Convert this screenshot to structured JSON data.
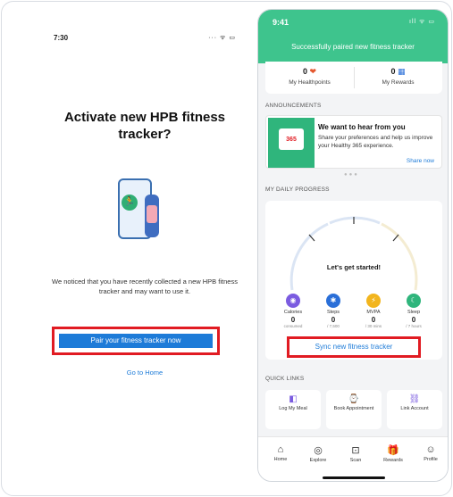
{
  "left": {
    "status_time": "7:30",
    "status_icons": "··· ᯤ ▭",
    "title": "Activate new HPB fitness tracker?",
    "description": "We noticed that you have recently collected a new HPB fitness tracker and may want to use it.",
    "pair_button": "Pair your fitness tracker now",
    "home_link": "Go to Home"
  },
  "right": {
    "status_time": "9:41",
    "status_icons": "ıll ᯤ ▭",
    "banner": "Successfully paired new fitness tracker",
    "healthpoints": {
      "value": "0",
      "label": "My Healthpoints"
    },
    "rewards": {
      "value": "0",
      "label": "My Rewards"
    },
    "announcements_header": "ANNOUNCEMENTS",
    "announcement": {
      "badge": "365",
      "title": "We want to hear from you",
      "body": "Share your preferences and help us improve your Healthy 365 experience.",
      "more": "Share now"
    },
    "progress_header": "MY DAILY PROGRESS",
    "progress_start": "Let's get started!",
    "metrics": [
      {
        "name": "Calories",
        "value": "0",
        "unit": "consumed",
        "color": "#7b5ce0",
        "icon": "◉"
      },
      {
        "name": "Steps",
        "value": "0",
        "unit": "/ 7,500",
        "color": "#2a6fd8",
        "icon": "✱"
      },
      {
        "name": "MVPA",
        "value": "0",
        "unit": "/ 30 mins",
        "color": "#f2b51e",
        "icon": "⚡"
      },
      {
        "name": "Sleep",
        "value": "0",
        "unit": "/ 7 hours",
        "color": "#2fb57c",
        "icon": "☾"
      }
    ],
    "sync_button": "Sync new fitness tracker",
    "quick_links_header": "QUICK LINKS",
    "quick_links": [
      {
        "label": "Log My Meal",
        "icon": "◧"
      },
      {
        "label": "Book Appointment",
        "icon": "⌚"
      },
      {
        "label": "Link Account",
        "icon": "⛓"
      }
    ],
    "nav": [
      {
        "label": "Home",
        "icon": "⌂"
      },
      {
        "label": "Explore",
        "icon": "◎"
      },
      {
        "label": "Scan",
        "icon": "⊡"
      },
      {
        "label": "Rewards",
        "icon": "🎁"
      },
      {
        "label": "Profile",
        "icon": "☺"
      }
    ]
  }
}
